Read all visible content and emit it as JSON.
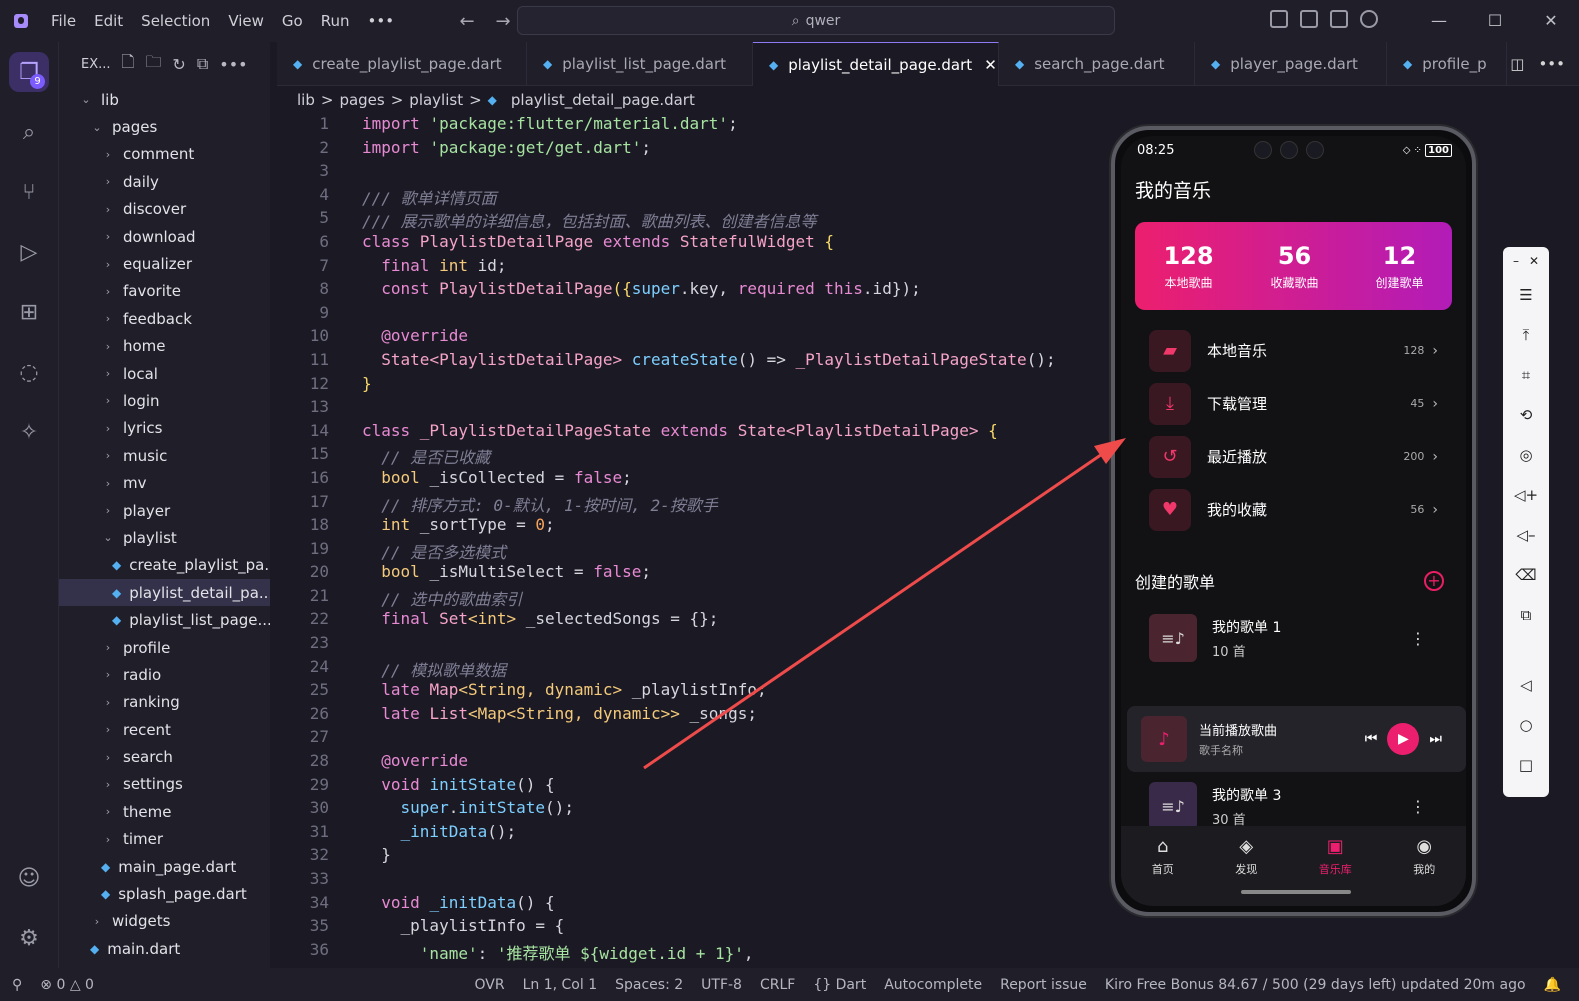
{
  "titlebar": {
    "menu": [
      "File",
      "Edit",
      "Selection",
      "View",
      "Go",
      "Run",
      "•••"
    ],
    "search": "qwer"
  },
  "activity": {
    "badge": "9"
  },
  "sidebar": {
    "title": "EX...",
    "items": [
      {
        "label": "lib",
        "depth": 0,
        "chev": "v",
        "type": "folder"
      },
      {
        "label": "pages",
        "depth": 1,
        "chev": "v",
        "type": "folder"
      },
      {
        "label": "comment",
        "depth": 2,
        "chev": ">",
        "type": "folder"
      },
      {
        "label": "daily",
        "depth": 2,
        "chev": ">",
        "type": "folder"
      },
      {
        "label": "discover",
        "depth": 2,
        "chev": ">",
        "type": "folder"
      },
      {
        "label": "download",
        "depth": 2,
        "chev": ">",
        "type": "folder"
      },
      {
        "label": "equalizer",
        "depth": 2,
        "chev": ">",
        "type": "folder"
      },
      {
        "label": "favorite",
        "depth": 2,
        "chev": ">",
        "type": "folder"
      },
      {
        "label": "feedback",
        "depth": 2,
        "chev": ">",
        "type": "folder"
      },
      {
        "label": "home",
        "depth": 2,
        "chev": ">",
        "type": "folder"
      },
      {
        "label": "local",
        "depth": 2,
        "chev": ">",
        "type": "folder"
      },
      {
        "label": "login",
        "depth": 2,
        "chev": ">",
        "type": "folder"
      },
      {
        "label": "lyrics",
        "depth": 2,
        "chev": ">",
        "type": "folder"
      },
      {
        "label": "music",
        "depth": 2,
        "chev": ">",
        "type": "folder"
      },
      {
        "label": "mv",
        "depth": 2,
        "chev": ">",
        "type": "folder"
      },
      {
        "label": "player",
        "depth": 2,
        "chev": ">",
        "type": "folder"
      },
      {
        "label": "playlist",
        "depth": 2,
        "chev": "v",
        "type": "folder"
      },
      {
        "label": "create_playlist_pa...",
        "depth": 3,
        "type": "dart"
      },
      {
        "label": "playlist_detail_pa...",
        "depth": 3,
        "type": "dart",
        "selected": true
      },
      {
        "label": "playlist_list_page....",
        "depth": 3,
        "type": "dart"
      },
      {
        "label": "profile",
        "depth": 2,
        "chev": ">",
        "type": "folder"
      },
      {
        "label": "radio",
        "depth": 2,
        "chev": ">",
        "type": "folder"
      },
      {
        "label": "ranking",
        "depth": 2,
        "chev": ">",
        "type": "folder"
      },
      {
        "label": "recent",
        "depth": 2,
        "chev": ">",
        "type": "folder"
      },
      {
        "label": "search",
        "depth": 2,
        "chev": ">",
        "type": "folder"
      },
      {
        "label": "settings",
        "depth": 2,
        "chev": ">",
        "type": "folder"
      },
      {
        "label": "theme",
        "depth": 2,
        "chev": ">",
        "type": "folder"
      },
      {
        "label": "timer",
        "depth": 2,
        "chev": ">",
        "type": "folder"
      },
      {
        "label": "main_page.dart",
        "depth": 2,
        "type": "dart"
      },
      {
        "label": "splash_page.dart",
        "depth": 2,
        "type": "dart"
      },
      {
        "label": "widgets",
        "depth": 1,
        "chev": ">",
        "type": "folder"
      },
      {
        "label": "main.dart",
        "depth": 1,
        "type": "dart"
      }
    ]
  },
  "tabs": [
    {
      "label": "create_playlist_page.dart",
      "width": 250
    },
    {
      "label": "playlist_list_page.dart",
      "width": 226
    },
    {
      "label": "playlist_detail_page.dart",
      "width": 246,
      "active": true
    },
    {
      "label": "search_page.dart",
      "width": 196
    },
    {
      "label": "player_page.dart",
      "width": 192
    },
    {
      "label": "profile_p",
      "width": 120
    }
  ],
  "breadcrumb": [
    "lib",
    ">",
    "pages",
    ">",
    "playlist",
    ">",
    "playlist_detail_page.dart"
  ],
  "code": [
    [
      [
        "import ",
        "kw"
      ],
      [
        "'package:flutter/material.dart'",
        "str"
      ],
      [
        ";",
        "p"
      ]
    ],
    [
      [
        "import ",
        "kw"
      ],
      [
        "'package:get/get.dart'",
        "str"
      ],
      [
        ";",
        "p"
      ]
    ],
    [],
    [
      [
        "/// 歌单详情页面",
        "cm"
      ]
    ],
    [
      [
        "/// 展示歌单的详细信息，包括封面、歌曲列表、创建者信息等",
        "cm"
      ]
    ],
    [
      [
        "class ",
        "kw"
      ],
      [
        "PlaylistDetailPage ",
        "cls"
      ],
      [
        "extends ",
        "kw"
      ],
      [
        "StatefulWidget ",
        "cls"
      ],
      [
        "{",
        "br"
      ]
    ],
    [
      [
        "  final ",
        "kw"
      ],
      [
        "int ",
        "ty"
      ],
      [
        "id;",
        "p"
      ]
    ],
    [
      [
        "  const ",
        "kw"
      ],
      [
        "PlaylistDetailPage",
        "cls"
      ],
      [
        "({",
        "br"
      ],
      [
        "super",
        "fn"
      ],
      [
        ".key, ",
        "p"
      ],
      [
        "required ",
        "kw"
      ],
      [
        "this",
        "kw"
      ],
      [
        ".id});",
        "p"
      ]
    ],
    [],
    [
      [
        "  @override",
        "kw"
      ]
    ],
    [
      [
        "  State",
        "cls"
      ],
      [
        "<PlaylistDetailPage> ",
        "cls"
      ],
      [
        "createState",
        "fn"
      ],
      [
        "() => ",
        "p"
      ],
      [
        "_PlaylistDetailPageState",
        "cls"
      ],
      [
        "();",
        "p"
      ]
    ],
    [
      [
        "}",
        "br"
      ]
    ],
    [],
    [
      [
        "class ",
        "kw"
      ],
      [
        "_PlaylistDetailPageState ",
        "cls"
      ],
      [
        "extends ",
        "kw"
      ],
      [
        "State",
        "cls"
      ],
      [
        "<PlaylistDetailPage> ",
        "cls"
      ],
      [
        "{",
        "br"
      ]
    ],
    [
      [
        "  // 是否已收藏",
        "cm"
      ]
    ],
    [
      [
        "  bool ",
        "ty"
      ],
      [
        "_isCollected = ",
        "p"
      ],
      [
        "false",
        "kw"
      ],
      [
        ";",
        "p"
      ]
    ],
    [
      [
        "  // 排序方式: 0-默认, 1-按时间, 2-按歌手",
        "cm"
      ]
    ],
    [
      [
        "  int ",
        "ty"
      ],
      [
        "_sortType = ",
        "p"
      ],
      [
        "0",
        "num"
      ],
      [
        ";",
        "p"
      ]
    ],
    [
      [
        "  // 是否多选模式",
        "cm"
      ]
    ],
    [
      [
        "  bool ",
        "ty"
      ],
      [
        "_isMultiSelect = ",
        "p"
      ],
      [
        "false",
        "kw"
      ],
      [
        ";",
        "p"
      ]
    ],
    [
      [
        "  // 选中的歌曲索引",
        "cm"
      ]
    ],
    [
      [
        "  final ",
        "kw"
      ],
      [
        "Set",
        "cls"
      ],
      [
        "<int> ",
        "ty"
      ],
      [
        "_selectedSongs = {};",
        "p"
      ]
    ],
    [],
    [
      [
        "  // 模拟歌单数据",
        "cm"
      ]
    ],
    [
      [
        "  late ",
        "kw"
      ],
      [
        "Map",
        "cls"
      ],
      [
        "<String, dynamic> ",
        "ty"
      ],
      [
        "_playlistInfo;",
        "p"
      ]
    ],
    [
      [
        "  late ",
        "kw"
      ],
      [
        "List",
        "cls"
      ],
      [
        "<Map<String, dynamic>> ",
        "ty"
      ],
      [
        "_songs;",
        "p"
      ]
    ],
    [],
    [
      [
        "  @override",
        "kw"
      ]
    ],
    [
      [
        "  void ",
        "kw"
      ],
      [
        "initState",
        "fn"
      ],
      [
        "() {",
        "p"
      ]
    ],
    [
      [
        "    super",
        "fn"
      ],
      [
        ".",
        "p"
      ],
      [
        "initState",
        "fn"
      ],
      [
        "();",
        "p"
      ]
    ],
    [
      [
        "    _initData",
        "fn"
      ],
      [
        "();",
        "p"
      ]
    ],
    [
      [
        "  }",
        "p"
      ]
    ],
    [],
    [
      [
        "  void ",
        "kw"
      ],
      [
        "_initData",
        "fn"
      ],
      [
        "() {",
        "p"
      ]
    ],
    [
      [
        "    _playlistInfo = {",
        "p"
      ]
    ],
    [
      [
        "      'name'",
        "str"
      ],
      [
        ": ",
        "p"
      ],
      [
        "'推荐歌单 ${widget.id + 1}'",
        "str"
      ],
      [
        ",",
        "p"
      ]
    ]
  ],
  "colors": {
    "kw": "#e88ad3",
    "str": "#a6e3a1",
    "cm": "#7f7e95",
    "cls": "#f5a3c7",
    "ty": "#f4c97a",
    "fn": "#7dcfff",
    "num": "#f7a35c",
    "p": "#d6d6de",
    "br": "#f9d96b"
  },
  "status": {
    "items": [
      "OVR",
      "Ln 1, Col 1",
      "Spaces: 2",
      "UTF-8",
      "CRLF",
      "{} Dart",
      "Autocomplete",
      "Report issue",
      "Kiro Free Bonus 84.67 / 500 (29 days left) updated 20m ago"
    ],
    "errors": "0",
    "warnings": "0"
  },
  "phone": {
    "time": "08:25",
    "battery": "100",
    "title": "我的音乐",
    "stats": [
      {
        "n": "128",
        "l": "本地歌曲"
      },
      {
        "n": "56",
        "l": "收藏歌曲"
      },
      {
        "n": "12",
        "l": "创建歌单"
      }
    ],
    "menu": [
      {
        "label": "本地音乐",
        "count": "128",
        "icon": "folder-icon"
      },
      {
        "label": "下载管理",
        "count": "45",
        "icon": "download-icon"
      },
      {
        "label": "最近播放",
        "count": "200",
        "icon": "history-icon"
      },
      {
        "label": "我的收藏",
        "count": "56",
        "icon": "heart-icon"
      }
    ],
    "section": "创建的歌单",
    "playlists": [
      {
        "name": "我的歌单 1",
        "count": "10 首"
      },
      {
        "name": "我的歌单 3",
        "count": "30 首"
      }
    ],
    "nowplaying": {
      "title": "当前播放歌曲",
      "artist": "歌手名称"
    },
    "nav": [
      {
        "label": "首页",
        "icon": "home-icon"
      },
      {
        "label": "发现",
        "icon": "compass-icon"
      },
      {
        "label": "音乐库",
        "icon": "library-icon",
        "active": true
      },
      {
        "label": "我的",
        "icon": "person-icon"
      }
    ]
  }
}
